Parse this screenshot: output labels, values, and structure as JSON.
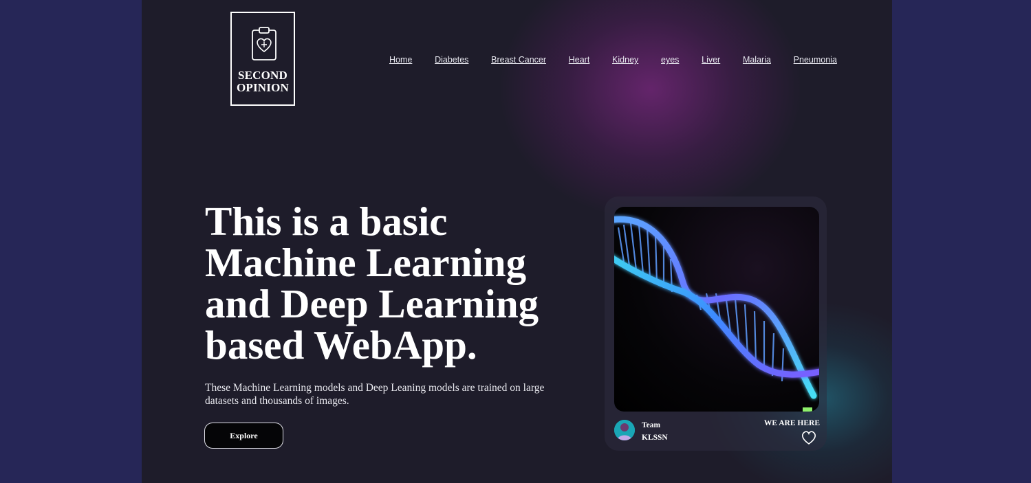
{
  "brand": {
    "logo_line1": "SECOND",
    "logo_line2": "OPINION",
    "logo_icon": "clipboard-heart-icon"
  },
  "nav": {
    "items": [
      {
        "label": "Home"
      },
      {
        "label": "Diabetes"
      },
      {
        "label": "Breast Cancer"
      },
      {
        "label": "Heart"
      },
      {
        "label": "Kidney"
      },
      {
        "label": "eyes"
      },
      {
        "label": "Liver"
      },
      {
        "label": "Malaria"
      },
      {
        "label": "Pneumonia"
      }
    ]
  },
  "hero": {
    "title": "This is a basic Machine Learning and Deep Learning based WebApp.",
    "subtitle": "These Machine Learning models and Deep Leaning models are trained on large datasets and thousands of images.",
    "button_label": "Explore"
  },
  "card": {
    "image": "dna-helix-image",
    "team_label": "Team",
    "team_name": "KLSSN",
    "tagline": "WE ARE HERE",
    "like_icon": "heart-outline-icon"
  },
  "colors": {
    "outer_background": "#262657",
    "page_background": "#1e1c2a",
    "text": "#ffffff",
    "glow_purple": "#702676",
    "glow_teal": "#228096",
    "dna_blue": "#4a7dff",
    "dna_cyan": "#3fd8f0"
  }
}
